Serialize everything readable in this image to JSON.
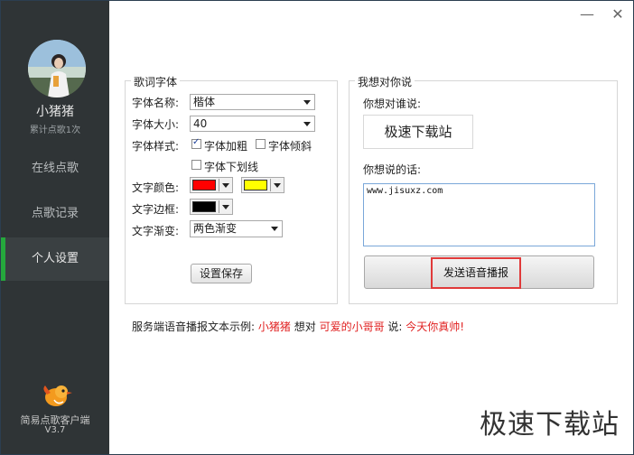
{
  "sidebar": {
    "username": "小猪猪",
    "subtext": "累计点歌1次",
    "items": [
      {
        "label": "在线点歌"
      },
      {
        "label": "点歌记录"
      },
      {
        "label": "个人设置"
      }
    ],
    "app_name": "简易点歌客户端",
    "app_version": "V3.7"
  },
  "window": {
    "minimize": "—",
    "close": "✕"
  },
  "font_group": {
    "title": "歌词字体",
    "font_name_label": "字体名称:",
    "font_name_value": "楷体",
    "font_size_label": "字体大小:",
    "font_size_value": "40",
    "font_style_label": "字体样式:",
    "bold_label": "字体加粗",
    "bold_checked": true,
    "italic_label": "字体倾斜",
    "italic_checked": false,
    "underline_label": "字体下划线",
    "underline_checked": false,
    "text_color_label": "文字颜色:",
    "text_color_1": "#ff0000",
    "text_color_2": "#ffff00",
    "border_label": "文字边框:",
    "border_color": "#000000",
    "gradient_label": "文字渐变:",
    "gradient_value": "两色渐变",
    "save_button": "设置保存"
  },
  "say_group": {
    "title": "我想对你说",
    "to_whom_label": "你想对谁说:",
    "to_whom_value": "极速下载站",
    "message_label": "你想说的话:",
    "message_value": "www.jisuxz.com",
    "send_button": "发送语音播报"
  },
  "example": {
    "prefix": "服务端语音播报文本示例:",
    "user": "小猪猪",
    "mid": "想对",
    "target": "可爱的小哥哥",
    "say": "说:",
    "message": "今天你真帅!"
  },
  "watermark": "极速下载站",
  "colors": {
    "sidebar": "#2f3436",
    "accent": "#25a83c",
    "highlight": "#e03a3a"
  }
}
